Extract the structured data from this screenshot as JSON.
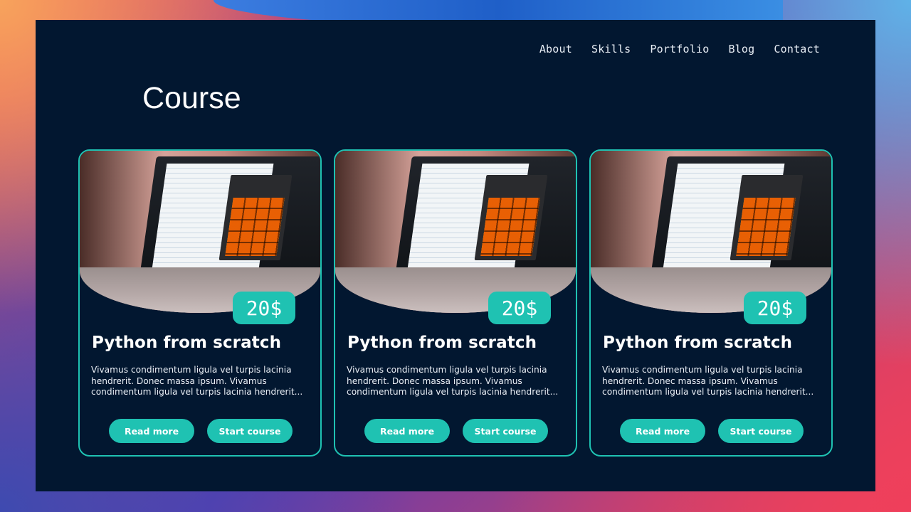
{
  "nav": {
    "items": [
      {
        "label": "About"
      },
      {
        "label": "Skills"
      },
      {
        "label": "Portfolio"
      },
      {
        "label": "Blog"
      },
      {
        "label": "Contact"
      }
    ]
  },
  "page": {
    "title": "Course"
  },
  "colors": {
    "background": "#021730",
    "accent": "#1fc2b2",
    "text": "#ffffff"
  },
  "cards": [
    {
      "price": "20$",
      "title": "Python from scratch",
      "description": "Vivamus condimentum ligula vel turpis lacinia hendrerit. Donec massa ipsum. Vivamus condimentum ligula vel turpis lacinia hendrerit...",
      "read_more_label": "Read more",
      "start_label": "Start course",
      "image_icon": "laptop-calculator-photo"
    },
    {
      "price": "20$",
      "title": "Python from scratch",
      "description": "Vivamus condimentum ligula vel turpis lacinia hendrerit. Donec massa ipsum. Vivamus condimentum ligula vel turpis lacinia hendrerit...",
      "read_more_label": "Read more",
      "start_label": "Start course",
      "image_icon": "laptop-calculator-photo"
    },
    {
      "price": "20$",
      "title": "Python from scratch",
      "description": "Vivamus condimentum ligula vel turpis lacinia hendrerit. Donec massa ipsum. Vivamus condimentum ligula vel turpis lacinia hendrerit...",
      "read_more_label": "Read more",
      "start_label": "Start course",
      "image_icon": "laptop-calculator-photo"
    }
  ]
}
